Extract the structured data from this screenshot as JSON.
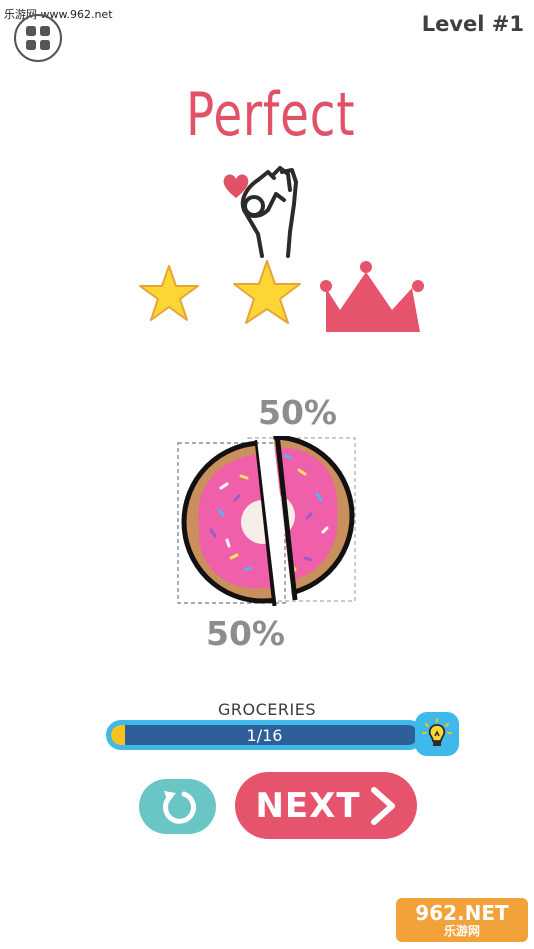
{
  "watermark": {
    "top_text": "乐游网 www.962.net",
    "bottom_logo": "962.NET",
    "bottom_sub": "乐游网"
  },
  "header": {
    "level_label": "Level #1",
    "menu_icon": "grid-menu-icon"
  },
  "result": {
    "title": "Perfect",
    "hand_icon": "ok-hand-icon",
    "heart_icon": "heart-icon",
    "stars": [
      {
        "icon": "star-icon",
        "earned": true
      },
      {
        "icon": "star-icon",
        "earned": true
      },
      {
        "icon": "crown-icon",
        "earned": true
      }
    ]
  },
  "puzzle": {
    "object_icon": "donut-icon",
    "top_piece_percent": "50%",
    "bottom_piece_percent": "50%"
  },
  "progress": {
    "category": "GROCERIES",
    "text": "1/16",
    "current": 1,
    "total": 16,
    "hint_icon": "lightbulb-icon"
  },
  "actions": {
    "restart_icon": "restart-icon",
    "next_label": "NEXT",
    "next_icon": "chevron-right-icon"
  },
  "colors": {
    "accent_pink": "#e6536c",
    "title_pink": "#e05268",
    "star_yellow": "#fcd635",
    "progress_blue": "#3fb8ea",
    "progress_dark": "#2e5f99",
    "progress_fill": "#f7c21c",
    "restart_teal": "#6ac6c4"
  }
}
